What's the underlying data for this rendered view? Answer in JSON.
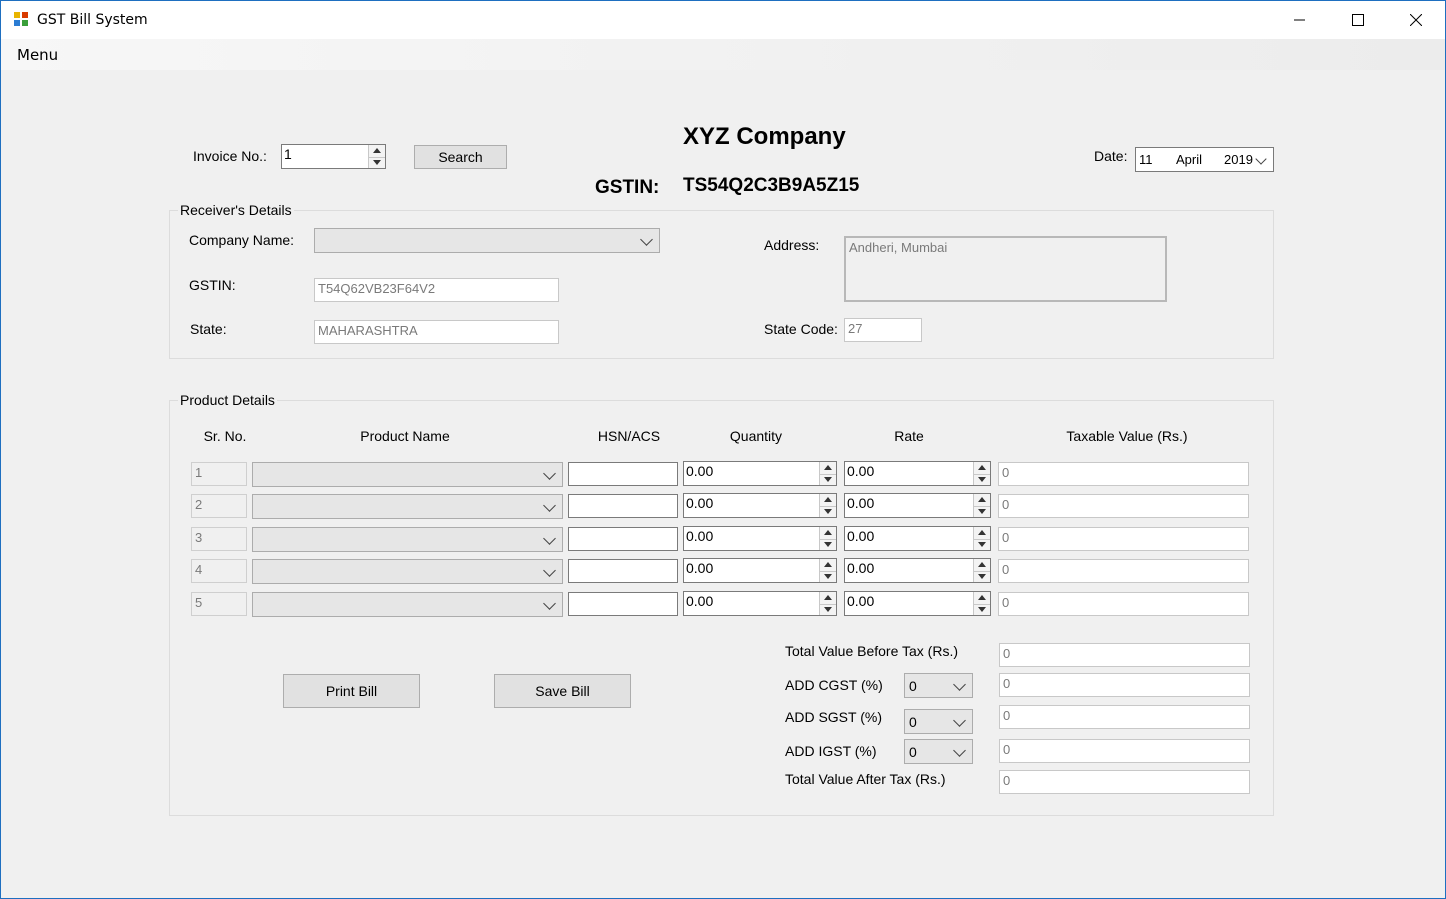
{
  "window": {
    "title": "GST Bill System",
    "minimize_label": "–",
    "maximize_label": "□",
    "close_label": "✕"
  },
  "menu": {
    "label": "Menu"
  },
  "header": {
    "invoice_label": "Invoice No.:",
    "invoice_value": "1",
    "search_label": "Search",
    "company_name": "XYZ Company",
    "gstin_label": "GSTIN:",
    "gstin_value": "TS54Q2C3B9A5Z15",
    "date_label": "Date:",
    "date_day": "11",
    "date_month": "April",
    "date_year": "2019"
  },
  "receiver": {
    "group_label": "Receiver's Details",
    "company_label": "Company Name:",
    "company_value": "",
    "gstin_label": "GSTIN:",
    "gstin_value": "T54Q62VB23F64V2",
    "state_label": "State:",
    "state_value": "MAHARASHTRA",
    "address_label": "Address:",
    "address_value": "Andheri, Mumbai",
    "state_code_label": "State Code:",
    "state_code_value": "27"
  },
  "products": {
    "group_label": "Product Details",
    "columns": [
      "Sr. No.",
      "Product Name",
      "HSN/ACS",
      "Quantity",
      "Rate",
      "Taxable Value (Rs.)"
    ],
    "rows": [
      {
        "sr": "1",
        "name": "",
        "hsn": "",
        "qty": "0.00",
        "rate": "0.00",
        "taxable": "0"
      },
      {
        "sr": "2",
        "name": "",
        "hsn": "",
        "qty": "0.00",
        "rate": "0.00",
        "taxable": "0"
      },
      {
        "sr": "3",
        "name": "",
        "hsn": "",
        "qty": "0.00",
        "rate": "0.00",
        "taxable": "0"
      },
      {
        "sr": "4",
        "name": "",
        "hsn": "",
        "qty": "0.00",
        "rate": "0.00",
        "taxable": "0"
      },
      {
        "sr": "5",
        "name": "",
        "hsn": "",
        "qty": "0.00",
        "rate": "0.00",
        "taxable": "0"
      }
    ]
  },
  "actions": {
    "print_label": "Print Bill",
    "save_label": "Save Bill"
  },
  "totals": {
    "before_tax_label": "Total Value Before Tax (Rs.)",
    "before_tax_value": "0",
    "cgst_label": "ADD CGST (%)",
    "cgst_rate": "0",
    "cgst_value": "0",
    "sgst_label": "ADD SGST (%)",
    "sgst_rate": "0",
    "sgst_value": "0",
    "igst_label": "ADD IGST (%)",
    "igst_rate": "0",
    "igst_value": "0",
    "after_tax_label": "Total Value After Tax (Rs.)",
    "after_tax_value": "0"
  }
}
